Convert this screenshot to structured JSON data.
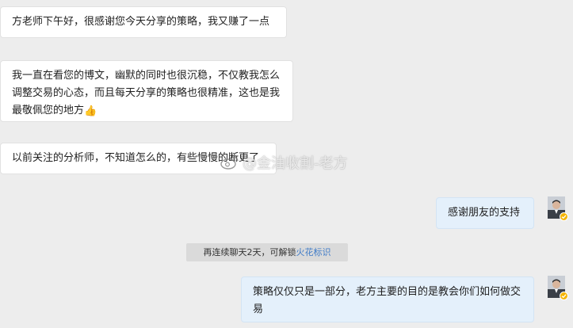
{
  "messages": [
    {
      "side": "left",
      "text": "方老师下午好，很感谢您今天分享的策略，我又赚了一点"
    },
    {
      "side": "left",
      "text": "我一直在看您的博文，幽默的同时也很沉稳，不仅教我怎么调整交易的心态，而且每天分享的策略也很精准，这也是我最敬佩您的地方",
      "emoji": "👍"
    },
    {
      "side": "left",
      "text": "以前关注的分析师，不知道怎么的，有些慢慢的断更了"
    },
    {
      "side": "right",
      "text": "感谢朋友的支持"
    },
    {
      "side": "right",
      "text": "策略仅仅只是一部分，老方主要的目的是教会你们如何做交易"
    }
  ],
  "system_notice": {
    "prefix": "再连续聊天2天，可解锁",
    "link": "火花标识"
  },
  "watermark": {
    "text": "@金油收割-老方"
  },
  "colors": {
    "background": "#ededed",
    "left_bubble": "#ffffff",
    "right_bubble": "#e4f0fb",
    "link": "#3f7bc7",
    "verified_badge": "#f5b400"
  }
}
